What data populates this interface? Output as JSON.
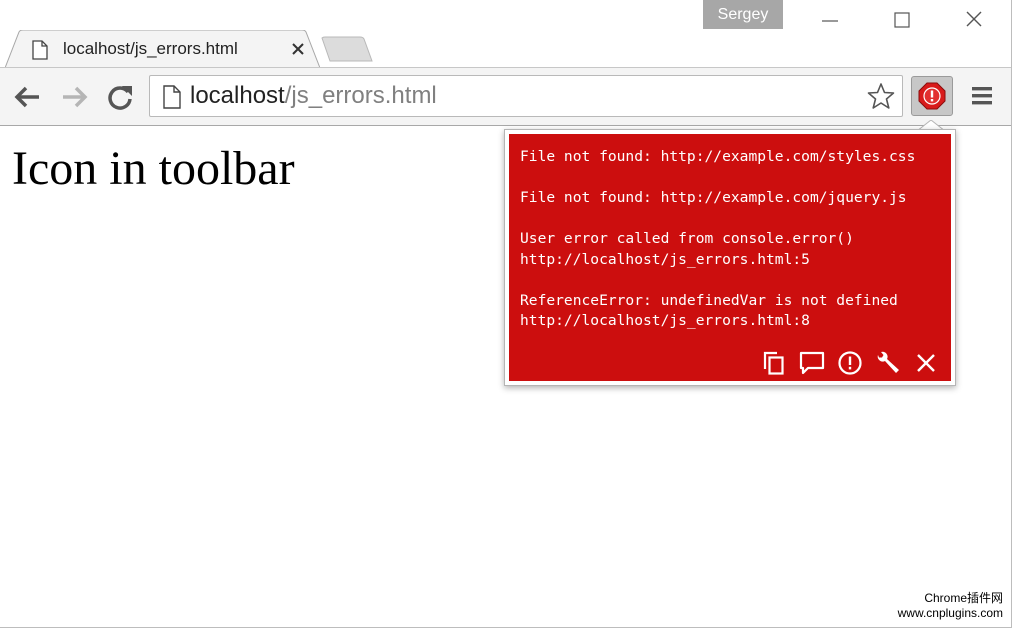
{
  "window": {
    "profile_name": "Sergey",
    "controls": [
      "minimize-icon",
      "maximize-icon",
      "close-icon"
    ]
  },
  "tabs": [
    {
      "title": "localhost/js_errors.html",
      "active": true,
      "icon": "page-icon"
    }
  ],
  "toolbar": {
    "back_icon": "back-arrow-icon",
    "forward_icon": "forward-arrow-icon",
    "reload_icon": "reload-icon",
    "url_host": "localhost",
    "url_path": "/js_errors.html",
    "bookmark_icon": "star-icon",
    "extension_icon": "error-alert-icon",
    "menu_icon": "hamburger-menu-icon"
  },
  "page": {
    "heading": "Icon in toolbar"
  },
  "popup": {
    "background_color": "#cc0e0e",
    "errors": [
      {
        "text": "File not found: http://example.com/styles.css"
      },
      {
        "text": "File not found: http://example.com/jquery.js"
      },
      {
        "text": "User error called from console.error()\nhttp://localhost/js_errors.html:5"
      },
      {
        "text": "ReferenceError: undefinedVar is not defined\nhttp://localhost/js_errors.html:8"
      }
    ],
    "actions": [
      "copy-icon",
      "comment-icon",
      "alert-icon",
      "wrench-icon",
      "close-icon"
    ]
  },
  "watermark": {
    "line1": "Chrome插件网",
    "line2": "www.cnplugins.com"
  }
}
